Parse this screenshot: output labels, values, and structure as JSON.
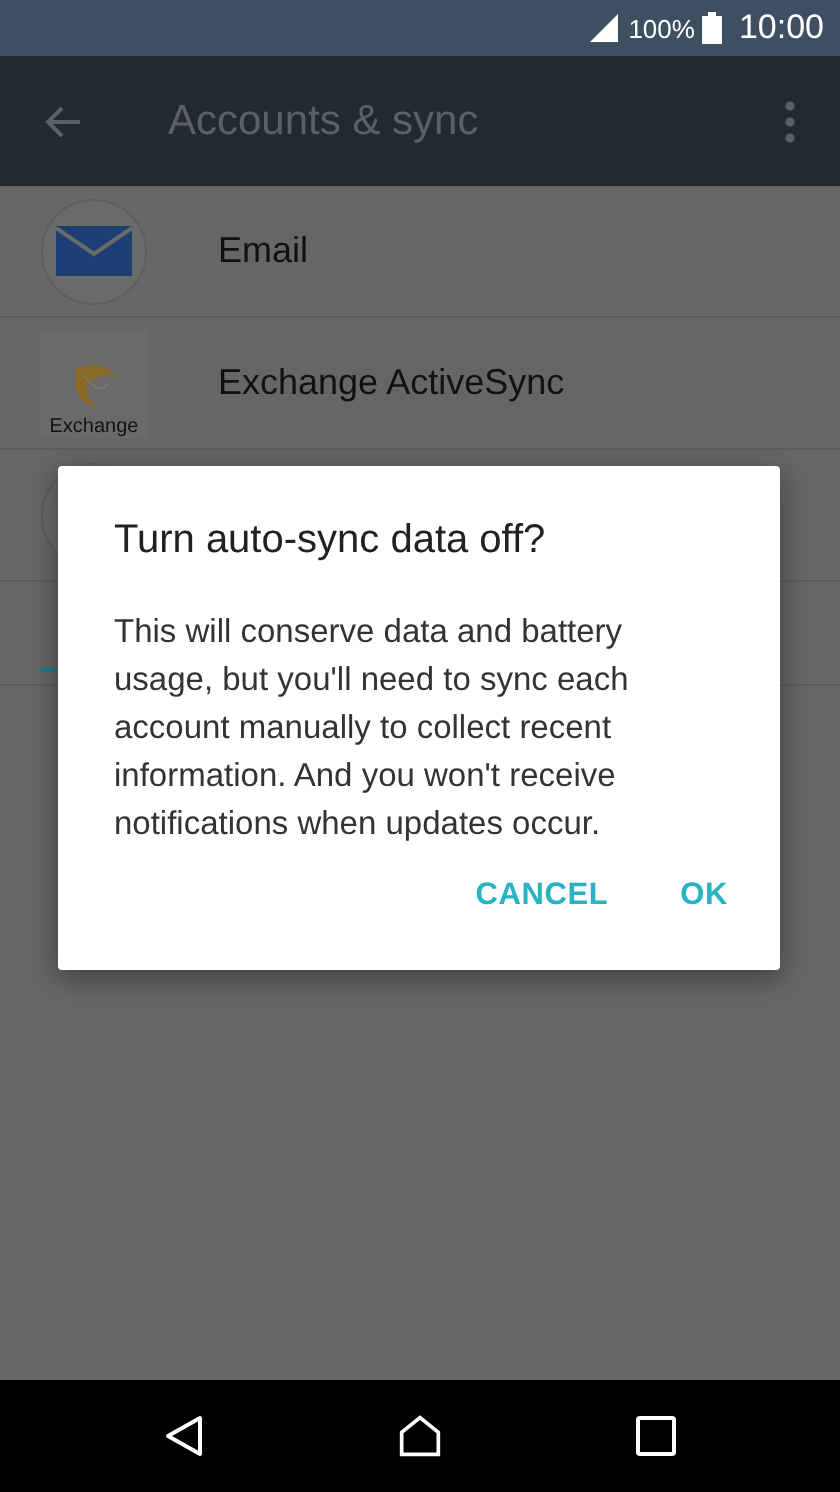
{
  "status_bar": {
    "battery": "100%",
    "time": "10:00"
  },
  "app_bar": {
    "title": "Accounts & sync"
  },
  "accounts": [
    {
      "kind": "email",
      "name": "Email"
    },
    {
      "kind": "exchange",
      "name": "Exchange ActiveSync",
      "logo_text": "Exchange"
    },
    {
      "kind": "hidden"
    }
  ],
  "dialog": {
    "title": "Turn auto-sync data off?",
    "message": "This will conserve data and battery usage, but you'll need to sync each account manually to collect recent information. And you won't receive notifications when updates occur.",
    "buttons": [
      "CANCEL",
      "OK"
    ]
  }
}
